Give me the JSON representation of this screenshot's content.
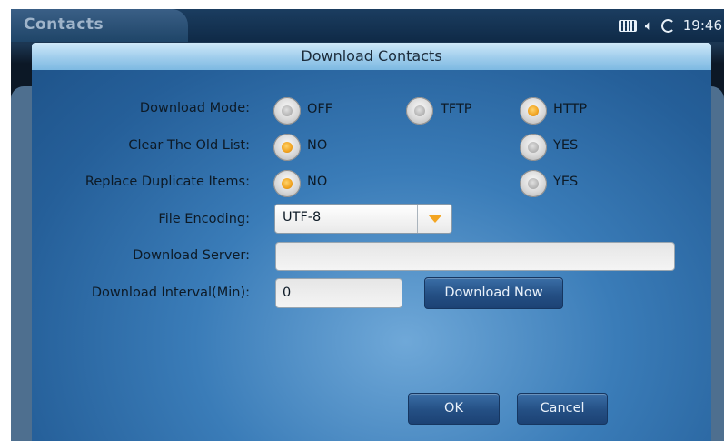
{
  "app": {
    "title": "Contacts"
  },
  "status": {
    "time": "19:46",
    "icons": [
      "keyboard-icon",
      "speaker-icon",
      "sync-icon"
    ]
  },
  "dialog": {
    "title": "Download Contacts",
    "download_mode": {
      "label": "Download Mode:",
      "options": [
        {
          "label": "OFF",
          "selected": false
        },
        {
          "label": "TFTP",
          "selected": false
        },
        {
          "label": "HTTP",
          "selected": true
        }
      ]
    },
    "clear_old_list": {
      "label": "Clear The Old List:",
      "options": [
        {
          "label": "NO",
          "selected": true
        },
        {
          "label": "YES",
          "selected": false
        }
      ]
    },
    "replace_duplicates": {
      "label": "Replace Duplicate Items:",
      "options": [
        {
          "label": "NO",
          "selected": true
        },
        {
          "label": "YES",
          "selected": false
        }
      ]
    },
    "file_encoding": {
      "label": "File Encoding:",
      "value": "UTF-8"
    },
    "download_server": {
      "label": "Download Server:",
      "value": ""
    },
    "download_interval": {
      "label": "Download Interval(Min):",
      "value": "0"
    },
    "download_now_label": "Download Now",
    "ok_label": "OK",
    "cancel_label": "Cancel"
  },
  "colors": {
    "accent": "#f0a21f",
    "dialog_bg": "#3a7cb8",
    "button": "#244f84"
  }
}
